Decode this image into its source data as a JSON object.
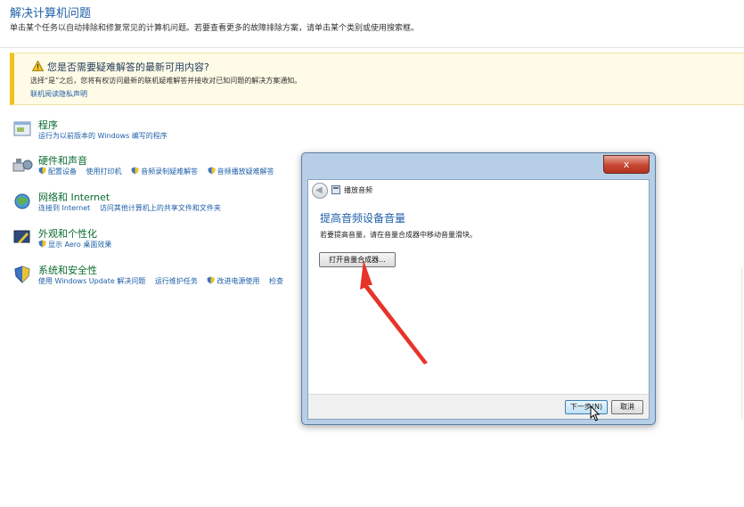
{
  "header": {
    "title": "解决计算机问题",
    "subtitle": "单击某个任务以自动排除和修复常见的计算机问题。若要查看更多的故障排除方案，请单击某个类别或使用搜索框。"
  },
  "info_bar": {
    "title": "您是否需要疑难解答的最新可用内容?",
    "text": "选择“是”之后，您将有权访问最新的联机疑难解答并接收对已知问题的解决方案通知。",
    "link": "联机阅读隐私声明"
  },
  "categories": [
    {
      "name": "程序",
      "links": [
        "运行为以前版本的 Windows 编写的程序"
      ]
    },
    {
      "name": "硬件和声音",
      "links": [
        "配置设备",
        "使用打印机",
        "音频录制疑难解答",
        "音频播放疑难解答"
      ]
    },
    {
      "name": "网络和 Internet",
      "links": [
        "连接到 Internet",
        "访问其他计算机上的共享文件和文件夹"
      ]
    },
    {
      "name": "外观和个性化",
      "links": [
        "显示 Aero 桌面效果"
      ]
    },
    {
      "name": "系统和安全性",
      "links": [
        "使用 Windows Update 解决问题",
        "运行维护任务",
        "改进电源使用",
        "检查"
      ]
    }
  ],
  "dialog": {
    "close_glyph": "x",
    "app_title": "播放音频",
    "heading": "提高音频设备音量",
    "body": "若要提高音量，请在音量合成器中移动音量滑块。",
    "mixer_button": "打开音量合成器...",
    "next_button": "下一步(N)",
    "cancel_button": "取消"
  },
  "colors": {
    "link_blue": "#1e5fa8",
    "category_green": "#0a6b2f",
    "warning_yellow": "#f1c21b",
    "close_red": "#c74632",
    "annotation_red": "#e8332a"
  }
}
